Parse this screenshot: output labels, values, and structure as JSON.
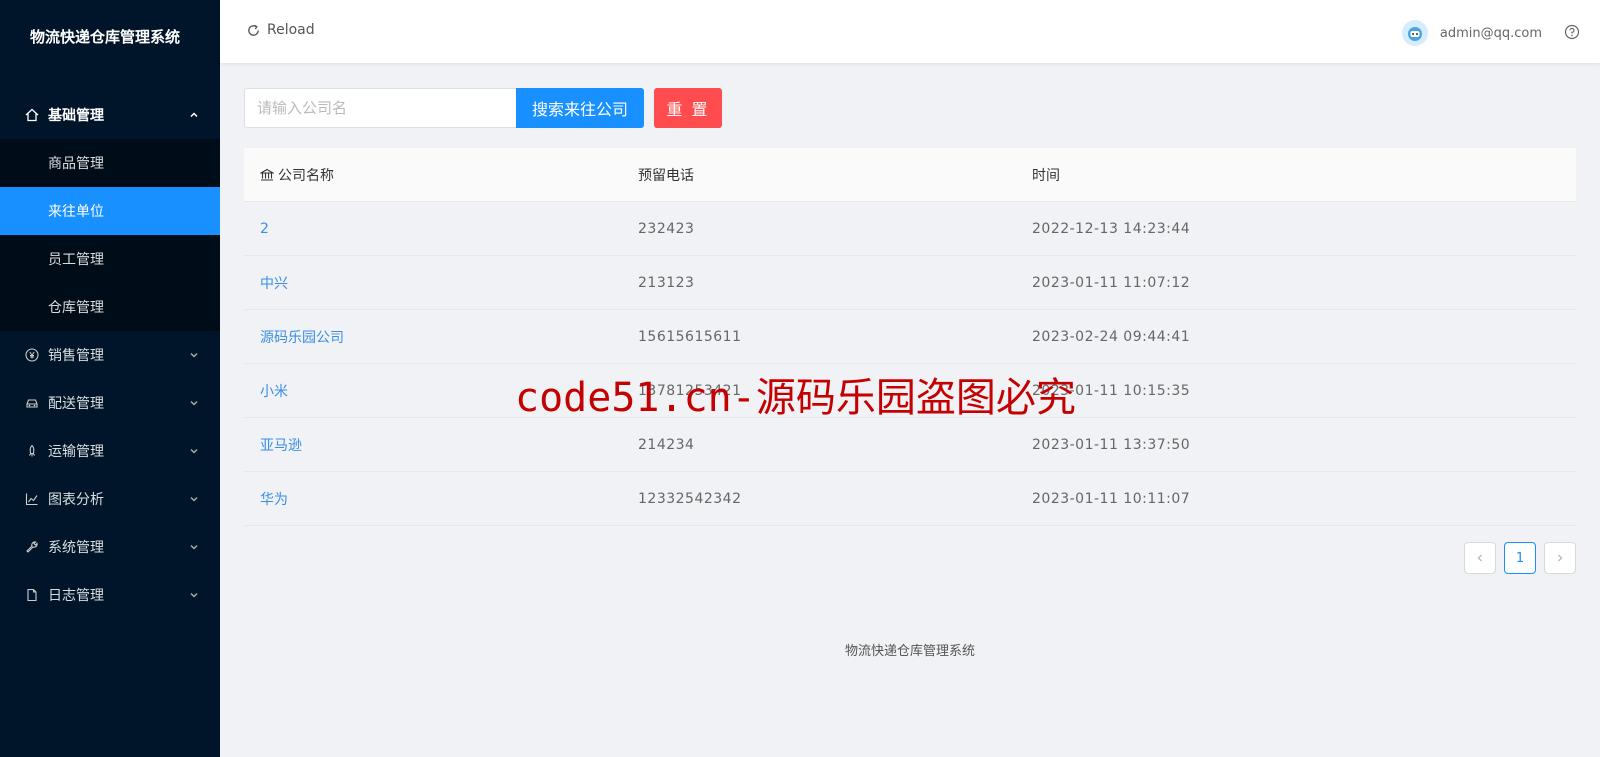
{
  "app": {
    "title": "物流快递仓库管理系统"
  },
  "sidebar": {
    "title": "物流快递仓库管理系统",
    "open_group": {
      "label": "基础管理",
      "icon": "home-icon"
    },
    "submenu": [
      {
        "label": "商品管理",
        "active": false
      },
      {
        "label": "来往单位",
        "active": true
      },
      {
        "label": "员工管理",
        "active": false
      },
      {
        "label": "仓库管理",
        "active": false
      }
    ],
    "groups": [
      {
        "label": "销售管理",
        "icon": "yen-circle-icon"
      },
      {
        "label": "配送管理",
        "icon": "car-icon"
      },
      {
        "label": "运输管理",
        "icon": "rocket-icon"
      },
      {
        "label": "图表分析",
        "icon": "line-chart-icon"
      },
      {
        "label": "系统管理",
        "icon": "tool-icon"
      },
      {
        "label": "日志管理",
        "icon": "file-icon"
      }
    ]
  },
  "header": {
    "reload_label": "Reload",
    "user_email": "admin@qq.com"
  },
  "search": {
    "placeholder": "请输入公司名",
    "value": "",
    "search_button": "搜索来往公司",
    "reset_button": "重 置"
  },
  "table": {
    "columns": [
      "公司名称",
      "预留电话",
      "时间"
    ],
    "rows": [
      {
        "name": "2",
        "phone": "232423",
        "time": "2022-12-13 14:23:44"
      },
      {
        "name": "中兴",
        "phone": "213123",
        "time": "2023-01-11 11:07:12"
      },
      {
        "name": "源码乐园公司",
        "phone": "15615615611",
        "time": "2023-02-24 09:44:41"
      },
      {
        "name": "小米",
        "phone": "13781253421",
        "time": "2023-01-11 10:15:35"
      },
      {
        "name": "亚马逊",
        "phone": "214234",
        "time": "2023-01-11 13:37:50"
      },
      {
        "name": "华为",
        "phone": "12332542342",
        "time": "2023-01-11 10:11:07"
      }
    ]
  },
  "pagination": {
    "current_page": "1"
  },
  "footer": {
    "text": "物流快递仓库管理系统"
  },
  "watermark": {
    "text": "code51.cn-源码乐园盗图必究"
  },
  "colors": {
    "sidebar_bg": "#001529",
    "primary": "#1890ff",
    "danger": "#ff4d4f",
    "link": "#3a8ee6"
  }
}
